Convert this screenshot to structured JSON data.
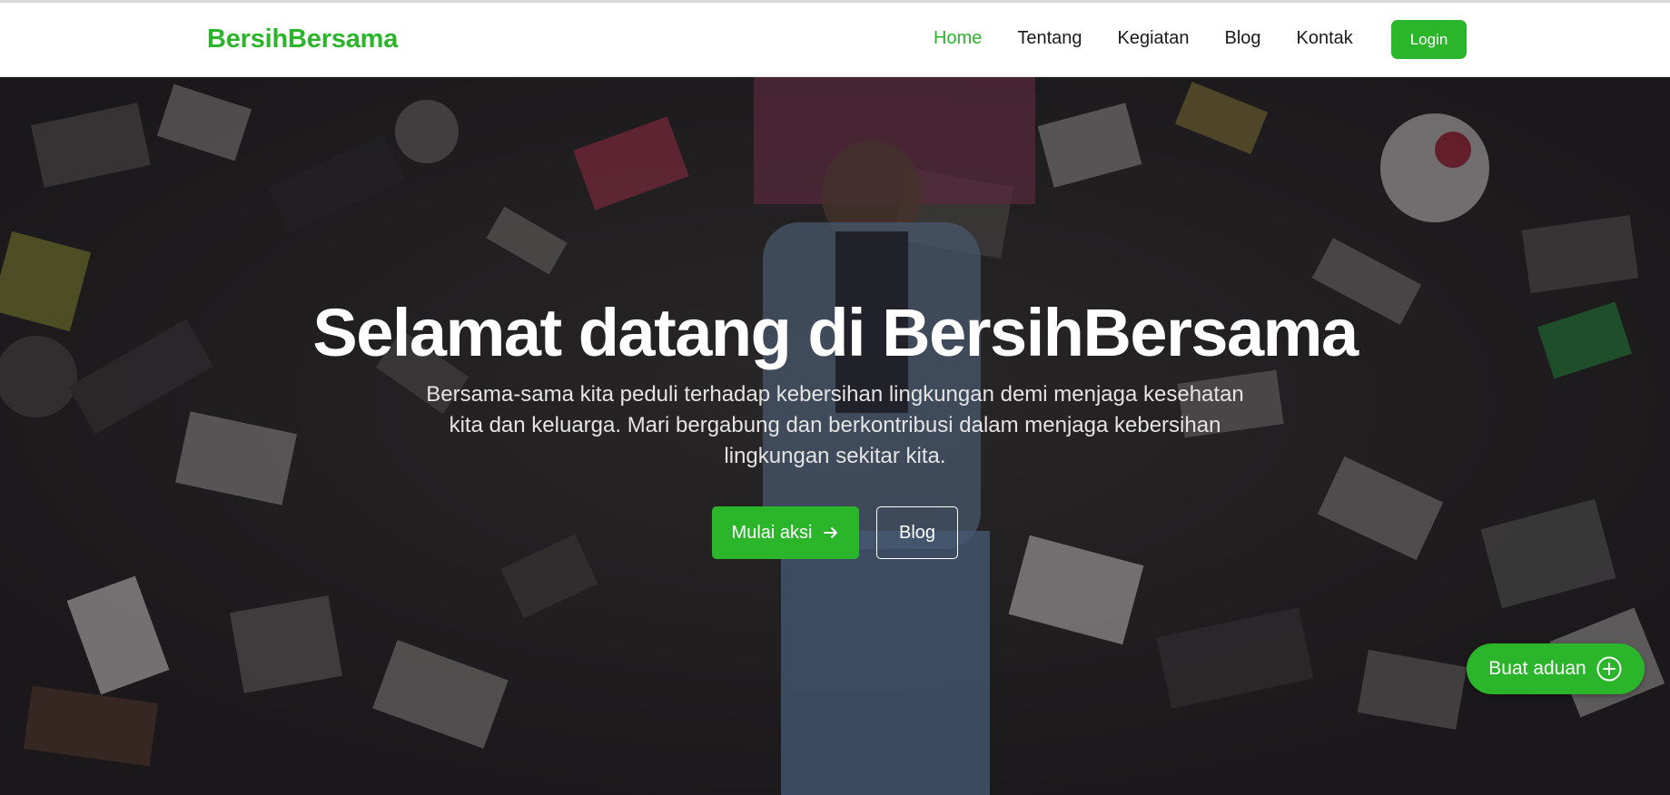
{
  "navbar": {
    "brand": "BersihBersama",
    "links": [
      "Home",
      "Tentang",
      "Kegiatan",
      "Blog",
      "Kontak"
    ],
    "active_link": "Home",
    "login_label": "Login"
  },
  "hero": {
    "title": "Selamat datang di BersihBersama",
    "description": "Bersama-sama kita peduli terhadap kebersihan lingkungan demi menjaga kesehatan kita dan keluarga. Mari bergabung dan berkontribusi dalam menjaga kebersihan lingkungan sekitar kita.",
    "primary_button": "Mulai aksi",
    "secondary_button": "Blog",
    "background_image": "person-lying-in-garbage-photo"
  },
  "fab": {
    "label": "Buat aduan",
    "icon": "plus-circle-icon"
  },
  "colors": {
    "accent": "#2bb52b",
    "navbar_bg": "#ffffff",
    "hero_text": "#ffffff"
  }
}
